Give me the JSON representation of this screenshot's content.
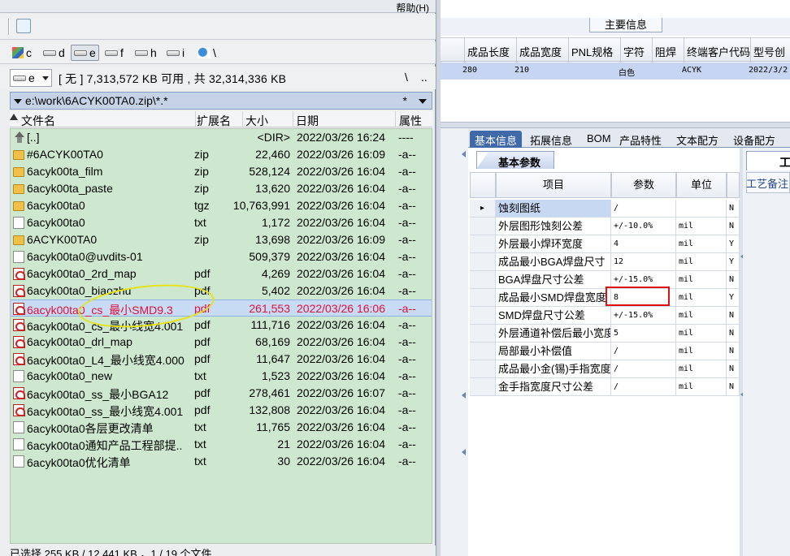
{
  "menu": {
    "help": "帮助(H)"
  },
  "drives": [
    {
      "letter": "c",
      "icon": "windows-drive-icon"
    },
    {
      "letter": "d",
      "icon": "hard-drive-icon"
    },
    {
      "letter": "e",
      "icon": "hard-drive-icon",
      "selected": true
    },
    {
      "letter": "f",
      "icon": "hard-drive-icon"
    },
    {
      "letter": "h",
      "icon": "hard-drive-icon"
    },
    {
      "letter": "i",
      "icon": "hard-drive-icon"
    },
    {
      "letter": "\\",
      "icon": "network-icon"
    }
  ],
  "drive_info": {
    "current_drive": "e",
    "free_text": "[ 无 ]  7,313,572 KB 可用 , 共 32,314,336 KB",
    "nav_root": "\\",
    "nav_up": ".."
  },
  "path": {
    "text": "e:\\work\\6ACYK00TA0.zip\\*.*",
    "filter": "*"
  },
  "columns": {
    "name": "文件名",
    "ext": "扩展名",
    "size": "大小",
    "date": "日期",
    "attr": "属性"
  },
  "files": [
    {
      "name": "[..]",
      "ext": "",
      "size": "<DIR>",
      "date": "2022/03/26 16:24",
      "attr": "----",
      "type": "up"
    },
    {
      "name": "#6ACYK00TA0",
      "ext": "zip",
      "size": "22,460",
      "date": "2022/03/26 16:09",
      "attr": "-a--",
      "type": "folder"
    },
    {
      "name": "6acyk00ta_film",
      "ext": "zip",
      "size": "528,124",
      "date": "2022/03/26 16:04",
      "attr": "-a--",
      "type": "folder"
    },
    {
      "name": "6acyk00ta_paste",
      "ext": "zip",
      "size": "13,620",
      "date": "2022/03/26 16:04",
      "attr": "-a--",
      "type": "folder"
    },
    {
      "name": "6acyk00ta0",
      "ext": "tgz",
      "size": "10,763,991",
      "date": "2022/03/26 16:04",
      "attr": "-a--",
      "type": "folder"
    },
    {
      "name": "6acyk00ta0",
      "ext": "txt",
      "size": "1,172",
      "date": "2022/03/26 16:04",
      "attr": "-a--",
      "type": "txt"
    },
    {
      "name": "6ACYK00TA0",
      "ext": "zip",
      "size": "13,698",
      "date": "2022/03/26 16:09",
      "attr": "-a--",
      "type": "folder"
    },
    {
      "name": "6acyk00ta0@uvdits-01",
      "ext": "",
      "size": "509,379",
      "date": "2022/03/26 16:04",
      "attr": "-a--",
      "type": "txt"
    },
    {
      "name": "6acyk00ta0_2rd_map",
      "ext": "pdf",
      "size": "4,269",
      "date": "2022/03/26 16:04",
      "attr": "-a--",
      "type": "pdf"
    },
    {
      "name": "6acyk00ta0_biaozhu",
      "ext": "pdf",
      "size": "5,402",
      "date": "2022/03/26 16:04",
      "attr": "-a--",
      "type": "pdf"
    },
    {
      "name": "6acyk00ta0_cs_最小SMD9.3",
      "ext": "pdf",
      "size": "261,553",
      "date": "2022/03/26 16:06",
      "attr": "-a--",
      "type": "pdf",
      "selected": true
    },
    {
      "name": "6acyk00ta0_cs_最小线宽4.001",
      "ext": "pdf",
      "size": "111,716",
      "date": "2022/03/26 16:04",
      "attr": "-a--",
      "type": "pdf"
    },
    {
      "name": "6acyk00ta0_drl_map",
      "ext": "pdf",
      "size": "68,169",
      "date": "2022/03/26 16:04",
      "attr": "-a--",
      "type": "pdf"
    },
    {
      "name": "6acyk00ta0_L4_最小线宽4.000",
      "ext": "pdf",
      "size": "11,647",
      "date": "2022/03/26 16:04",
      "attr": "-a--",
      "type": "pdf"
    },
    {
      "name": "6acyk00ta0_new",
      "ext": "txt",
      "size": "1,523",
      "date": "2022/03/26 16:04",
      "attr": "-a--",
      "type": "txt"
    },
    {
      "name": "6acyk00ta0_ss_最小BGA12",
      "ext": "pdf",
      "size": "278,461",
      "date": "2022/03/26 16:07",
      "attr": "-a--",
      "type": "pdf"
    },
    {
      "name": "6acyk00ta0_ss_最小线宽4.001",
      "ext": "pdf",
      "size": "132,808",
      "date": "2022/03/26 16:04",
      "attr": "-a--",
      "type": "pdf"
    },
    {
      "name": "6acyk00ta0各层更改清单",
      "ext": "txt",
      "size": "11,765",
      "date": "2022/03/26 16:04",
      "attr": "-a--",
      "type": "txt"
    },
    {
      "name": "6acyk00ta0通知产品工程部提..",
      "ext": "txt",
      "size": "21",
      "date": "2022/03/26 16:04",
      "attr": "-a--",
      "type": "txt"
    },
    {
      "name": "6acyk00ta0优化清单",
      "ext": "txt",
      "size": "30",
      "date": "2022/03/26 16:04",
      "attr": "-a--",
      "type": "txt"
    }
  ],
  "status_text": "已选择 255 KB / 12,441 KB ，1 / 19 个文件",
  "main_info": {
    "title": "主要信息",
    "columns": [
      "成品长度",
      "成品宽度",
      "PNL规格",
      "字符",
      "阻焊",
      "终端客户代码",
      "型号创"
    ],
    "row": [
      "280",
      "210",
      "",
      "白色",
      "",
      "ACYK",
      "2022/3/2"
    ]
  },
  "tabs": [
    "基本信息",
    "拓展信息",
    "BOM",
    "产品特性",
    "文本配方",
    "设备配方"
  ],
  "active_tab": 0,
  "basic_params": {
    "title": "基本参数",
    "headers": {
      "item": "项目",
      "param": "参数",
      "unit": "单位"
    },
    "rows": [
      {
        "item": "蚀刻图纸",
        "param": "/",
        "unit": "",
        "flag": "N"
      },
      {
        "item": "外层图形蚀刻公差",
        "param": "+/-10.0%",
        "unit": "mil",
        "flag": "N"
      },
      {
        "item": "外层最小焊环宽度",
        "param": "4",
        "unit": "mil",
        "flag": "Y"
      },
      {
        "item": "成品最小BGA焊盘尺寸",
        "param": "12",
        "unit": "mil",
        "flag": "Y"
      },
      {
        "item": "BGA焊盘尺寸公差",
        "param": "+/-15.0%",
        "unit": "mil",
        "flag": "N"
      },
      {
        "item": "成品最小SMD焊盘宽度",
        "param": "8",
        "unit": "mil",
        "flag": "Y"
      },
      {
        "item": "SMD焊盘尺寸公差",
        "param": "+/-15.0%",
        "unit": "mil",
        "flag": "N"
      },
      {
        "item": "外层通道补偿后最小宽度",
        "param": "5",
        "unit": "mil",
        "flag": "N"
      },
      {
        "item": "局部最小补偿值",
        "param": "/",
        "unit": "mil",
        "flag": "N"
      },
      {
        "item": "成品最小金(锡)手指宽度",
        "param": "/",
        "unit": "mil",
        "flag": "N"
      },
      {
        "item": "金手指宽度尺寸公差",
        "param": "/",
        "unit": "mil",
        "flag": "N"
      }
    ]
  },
  "process_panel": {
    "title": "工艺",
    "remark_label": "工艺备注"
  }
}
